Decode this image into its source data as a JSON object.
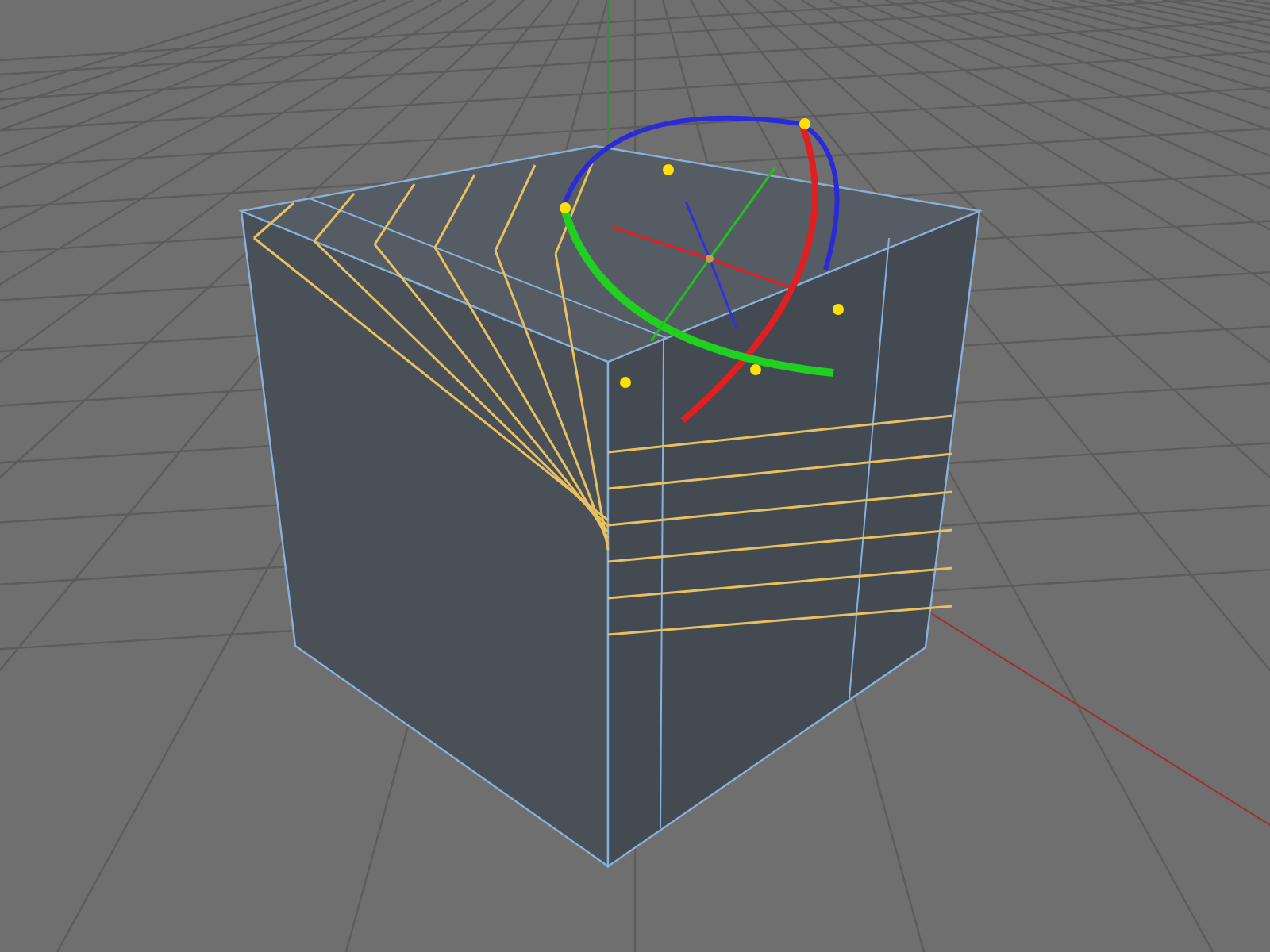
{
  "viewport": {
    "show_grid": true,
    "show_gizmo": true,
    "show_cuts": true
  }
}
